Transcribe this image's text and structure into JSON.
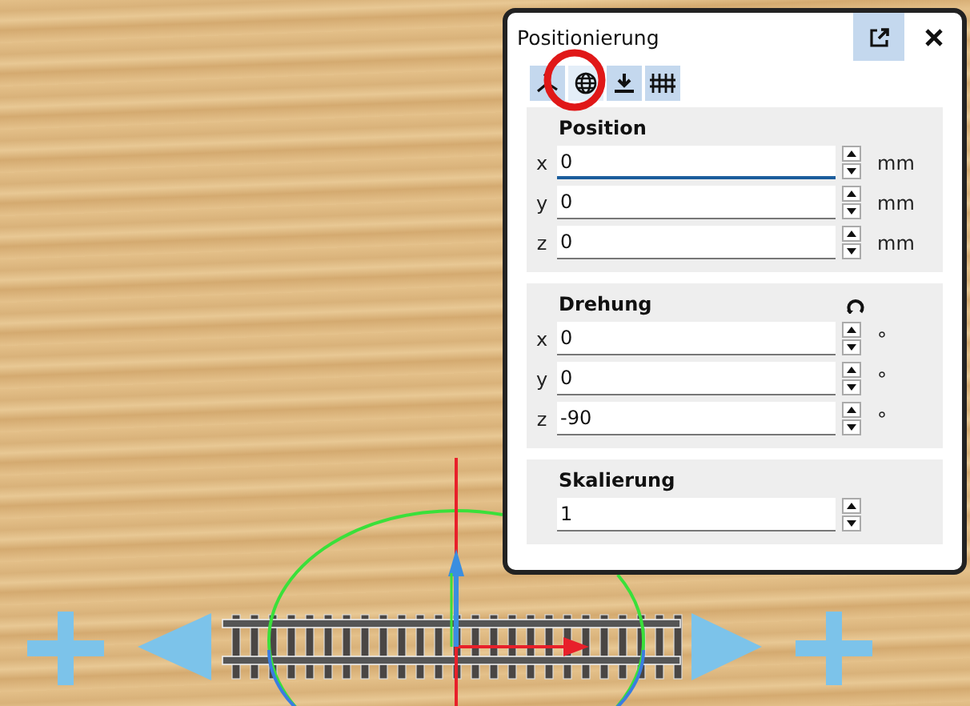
{
  "window": {
    "title": "Positionierung"
  },
  "tabs": [
    {
      "kind": "axes",
      "selected": false
    },
    {
      "kind": "globe",
      "selected": true
    },
    {
      "kind": "drop",
      "selected": false
    },
    {
      "kind": "grid",
      "selected": false
    }
  ],
  "highlight": {
    "on": true
  },
  "sections": [
    {
      "title": "Position",
      "reset": false,
      "fields": [
        {
          "label": "x",
          "value": "0",
          "unit": "mm",
          "focused": true
        },
        {
          "label": "y",
          "value": "0",
          "unit": "mm",
          "focused": false
        },
        {
          "label": "z",
          "value": "0",
          "unit": "mm",
          "focused": false
        }
      ]
    },
    {
      "title": "Drehung",
      "reset": true,
      "fields": [
        {
          "label": "x",
          "value": "0",
          "unit": "°",
          "focused": false
        },
        {
          "label": "y",
          "value": "0",
          "unit": "°",
          "focused": false
        },
        {
          "label": "z",
          "value": "-90",
          "unit": "°",
          "focused": false
        }
      ]
    },
    {
      "title": "Skalierung",
      "reset": false,
      "fields": [
        {
          "value": "1",
          "focused": false
        }
      ]
    }
  ]
}
